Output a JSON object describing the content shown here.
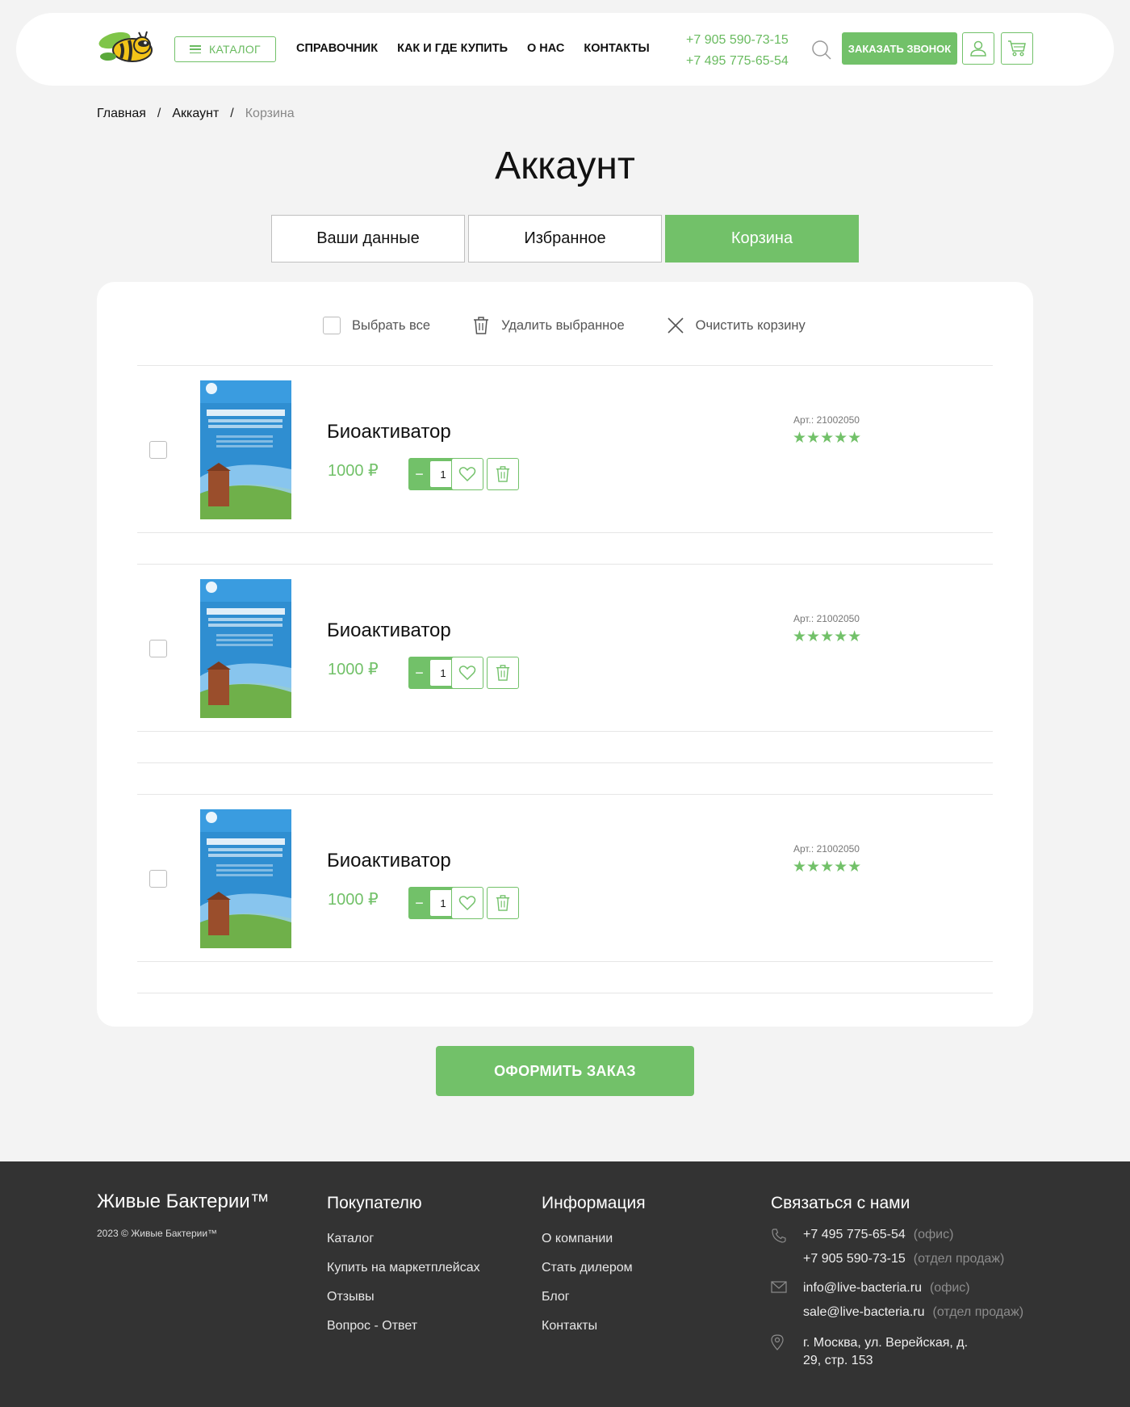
{
  "header": {
    "catalog_label": "КАТАЛОГ",
    "nav": [
      "СПРАВОЧНИК",
      "КАК И ГДЕ КУПИТЬ",
      "О НАС",
      "КОНТАКТЫ"
    ],
    "phones": [
      "+7 905 590-73-15",
      "+7 495 775-65-54"
    ],
    "call_label": "ЗАКАЗАТЬ ЗВОНОК"
  },
  "breadcrumb": [
    "Главная",
    "Аккаунт",
    "Корзина"
  ],
  "breadcrumb_sep": "/",
  "page_title": "Аккаунт",
  "tabs": [
    {
      "label": "Ваши данные",
      "active": false
    },
    {
      "label": "Избранное",
      "active": false
    },
    {
      "label": "Корзина",
      "active": true
    }
  ],
  "cart": {
    "select_all": "Выбрать все",
    "delete_selected": "Удалить выбранное",
    "clear_cart": "Очистить корзину",
    "items": [
      {
        "name": "Биоактиватор",
        "price": "1000 ₽",
        "qty": "1",
        "sku": "Арт.: 21002050",
        "stars": "★★★★★",
        "minus": "−",
        "plus": "+"
      },
      {
        "name": "Биоактиватор",
        "price": "1000 ₽",
        "qty": "1",
        "sku": "Арт.: 21002050",
        "stars": "★★★★★",
        "minus": "−",
        "plus": "+"
      },
      {
        "name": "Биоактиватор",
        "price": "1000 ₽",
        "qty": "1",
        "sku": "Арт.: 21002050",
        "stars": "★★★★★",
        "minus": "−",
        "plus": "+"
      }
    ]
  },
  "order_button": "ОФОРМИТЬ ЗАКАЗ",
  "footer": {
    "brand": "Живые Бактерии™",
    "copyright": "2023 © Живые Бактерии™",
    "buyer": {
      "title": "Покупателю",
      "links": [
        "Каталог",
        "Купить на маркетплейсах",
        "Отзывы",
        "Вопрос - Ответ"
      ]
    },
    "info": {
      "title": "Информация",
      "links": [
        "О компании",
        "Стать дилером",
        "Блог",
        "Контакты"
      ]
    },
    "contacts": {
      "title": "Связаться с нами",
      "phone_office": "+7 495 775-65-54",
      "phone_office_note": "(офис)",
      "phone_sales": "+7 905 590-73-15",
      "phone_sales_note": "(отдел продаж)",
      "email_office": "info@live-bacteria.ru",
      "email_office_note": "(офис)",
      "email_sales": "sale@live-bacteria.ru",
      "email_sales_note": "(отдел продаж)",
      "address_line1": "г. Москва, ул. Верейская, д.",
      "address_line2": "29, стр. 153"
    }
  },
  "colors": {
    "accent": "#72c169",
    "footer_bg": "#333333",
    "page_bg": "#f3f3f3"
  },
  "icons": [
    "logo-bee-icon",
    "menu-icon",
    "search-icon",
    "user-icon",
    "cart-icon",
    "trash-icon",
    "close-icon",
    "heart-icon",
    "phone-icon",
    "mail-icon",
    "location-pin-icon"
  ]
}
